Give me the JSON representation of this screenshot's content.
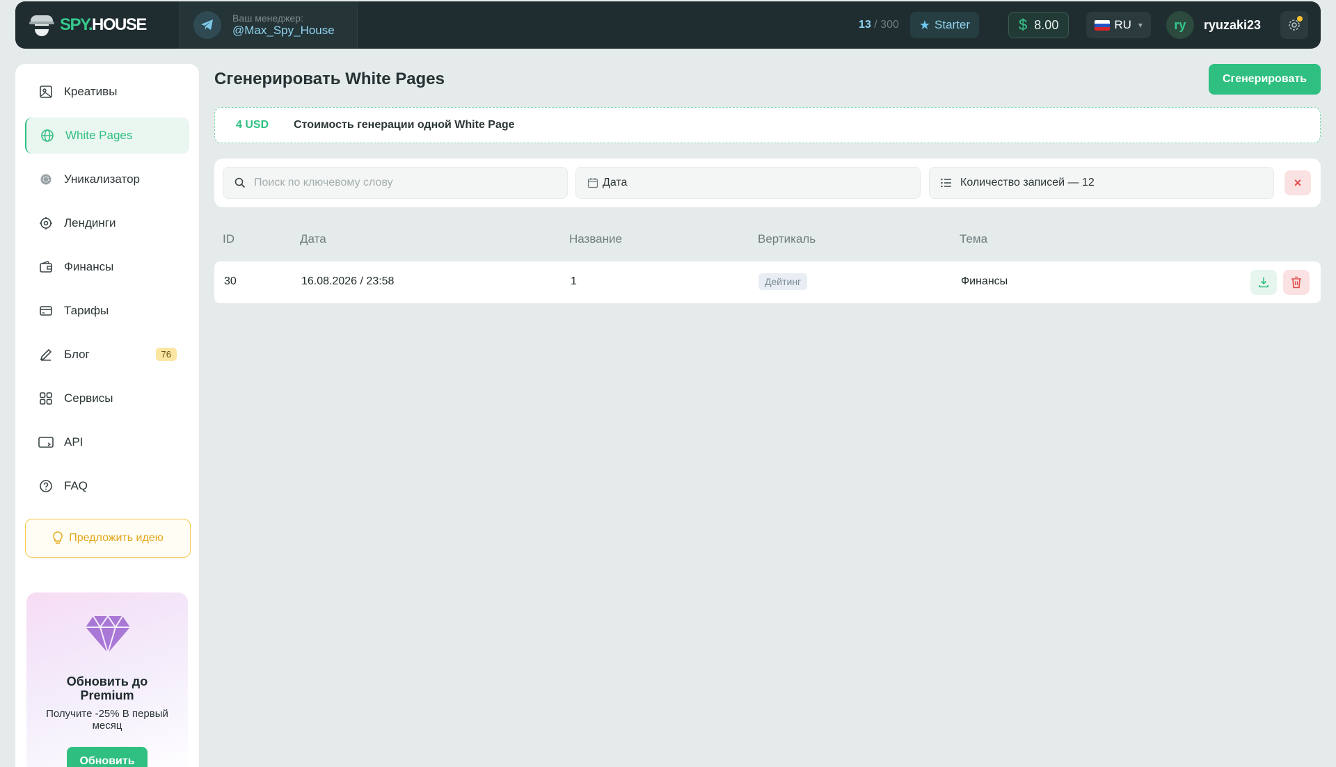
{
  "brand": {
    "logo_left": "SPY.",
    "logo_right": "HOUSE"
  },
  "manager": {
    "label": "Ваш менеджер:",
    "name": "@Max_Spy_House"
  },
  "header": {
    "counter_used": "13",
    "counter_total": " / 300",
    "plan": "Starter",
    "currency_symbol": "$",
    "balance": "8.00",
    "language": "RU",
    "avatar_initials": "ry",
    "username": "ryuzaki23"
  },
  "sidebar": {
    "items": [
      {
        "label": "Креативы",
        "icon": "image-icon"
      },
      {
        "label": "White Pages",
        "icon": "globe-icon",
        "active": true
      },
      {
        "label": "Уникализатор",
        "icon": "uniq-icon"
      },
      {
        "label": "Лендинги",
        "icon": "target-icon"
      },
      {
        "label": "Финансы",
        "icon": "wallet-icon"
      },
      {
        "label": "Тарифы",
        "icon": "card-icon"
      },
      {
        "label": "Блог",
        "icon": "pen-icon",
        "badge": "76"
      },
      {
        "label": "Сервисы",
        "icon": "grid-icon"
      },
      {
        "label": "API",
        "icon": "api-icon"
      },
      {
        "label": "FAQ",
        "icon": "question-icon"
      }
    ],
    "idea_button": "Предложить идею",
    "promo": {
      "title": "Обновить до Premium",
      "subtitle": "Получите -25% В первый месяц",
      "button": "Обновить"
    }
  },
  "main": {
    "title": "Сгенерировать White Pages",
    "generate_button": "Сгенерировать",
    "cost": {
      "price": "4 USD",
      "text": "Стоимость генерации одной White Page"
    },
    "filters": {
      "search_placeholder": "Поиск по ключевому слову",
      "date_label": "Дата",
      "count_label": "Количество записей — 12"
    },
    "table": {
      "columns": [
        "ID",
        "Дата",
        "Название",
        "Вертикаль",
        "Тема"
      ],
      "rows": [
        {
          "id": "30",
          "date": "16.08.2026 / 23:58",
          "name": "1",
          "vertical": "Дейтинг",
          "theme": "Финансы"
        }
      ]
    }
  },
  "colors": {
    "accent": "#2fbf81",
    "topbar": "#1f2d30",
    "background": "#e5eaeb",
    "danger": "#e14b4b",
    "warning": "#f2c94c"
  }
}
